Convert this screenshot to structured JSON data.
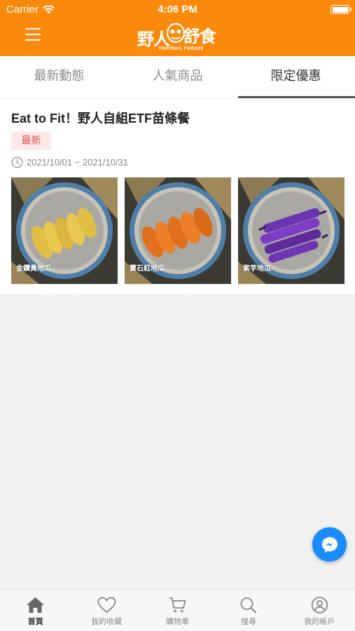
{
  "status_bar": {
    "carrier": "Carrier",
    "time": "4:06 PM"
  },
  "header": {
    "logo_left": "野人",
    "logo_right": "舒食",
    "logo_sub": "TOPIONS FOODIE"
  },
  "tabs": [
    {
      "label": "最新動態",
      "active": false
    },
    {
      "label": "人氣商品",
      "active": false
    },
    {
      "label": "限定優惠",
      "active": true
    }
  ],
  "promo": {
    "title": "Eat to Fit！野人自組ETF苗條餐",
    "tag": "最新",
    "date_range": "2021/10/01 ~ 2021/10/31",
    "photos": [
      {
        "label": "金鑽黃地瓜"
      },
      {
        "label": "寶石紅地瓜"
      },
      {
        "label": "紫芋地瓜"
      }
    ]
  },
  "tabbar": [
    {
      "label": "首頁",
      "icon": "home-icon",
      "active": true
    },
    {
      "label": "我的收藏",
      "icon": "heart-icon",
      "active": false
    },
    {
      "label": "購物車",
      "icon": "cart-icon",
      "active": false
    },
    {
      "label": "搜尋",
      "icon": "search-icon",
      "active": false
    },
    {
      "label": "我的帳戶",
      "icon": "account-icon",
      "active": false
    }
  ],
  "colors": {
    "brand": "#fb8a0c",
    "tag_text": "#e04a4a",
    "tag_bg": "#fde9e9",
    "messenger": "#1a8cff"
  }
}
